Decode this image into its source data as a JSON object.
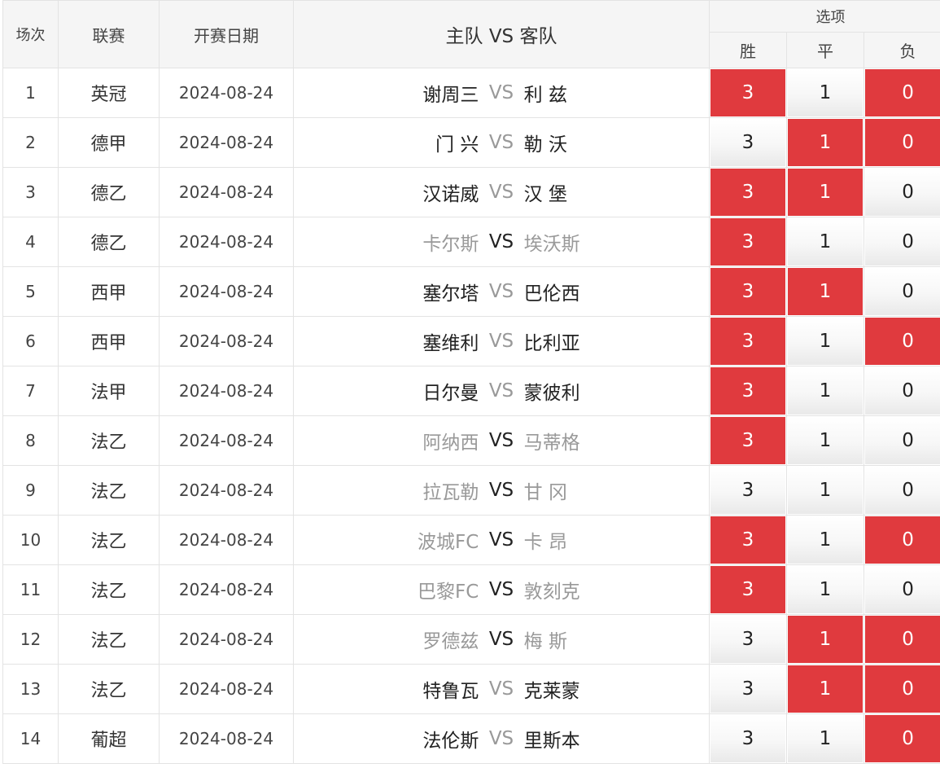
{
  "header": {
    "col_index": "场次",
    "col_league": "联赛",
    "col_date": "开赛日期",
    "col_match": "主队 VS 客队",
    "col_options": "选项",
    "opt_win": "胜",
    "opt_draw": "平",
    "opt_lose": "负"
  },
  "vs_label": "VS",
  "colors": {
    "selected": "#e03a3e",
    "unselected_text": "#222222",
    "dim_text": "#999999"
  },
  "rows": [
    {
      "idx": "1",
      "league": "英冠",
      "date": "2024-08-24",
      "home": "谢周三",
      "away": "利 兹",
      "vs_dim": true,
      "home_dim": false,
      "away_dim": false,
      "w": "3",
      "d": "1",
      "l": "0",
      "sel": [
        true,
        false,
        true
      ]
    },
    {
      "idx": "2",
      "league": "德甲",
      "date": "2024-08-24",
      "home": "门 兴",
      "away": "勒 沃",
      "vs_dim": true,
      "home_dim": false,
      "away_dim": false,
      "w": "3",
      "d": "1",
      "l": "0",
      "sel": [
        false,
        true,
        true
      ]
    },
    {
      "idx": "3",
      "league": "德乙",
      "date": "2024-08-24",
      "home": "汉诺威",
      "away": "汉 堡",
      "vs_dim": true,
      "home_dim": false,
      "away_dim": false,
      "w": "3",
      "d": "1",
      "l": "0",
      "sel": [
        true,
        true,
        false
      ]
    },
    {
      "idx": "4",
      "league": "德乙",
      "date": "2024-08-24",
      "home": "卡尔斯",
      "away": "埃沃斯",
      "vs_dim": false,
      "home_dim": true,
      "away_dim": true,
      "w": "3",
      "d": "1",
      "l": "0",
      "sel": [
        true,
        false,
        false
      ]
    },
    {
      "idx": "5",
      "league": "西甲",
      "date": "2024-08-24",
      "home": "塞尔塔",
      "away": "巴伦西",
      "vs_dim": true,
      "home_dim": false,
      "away_dim": false,
      "w": "3",
      "d": "1",
      "l": "0",
      "sel": [
        true,
        true,
        false
      ]
    },
    {
      "idx": "6",
      "league": "西甲",
      "date": "2024-08-24",
      "home": "塞维利",
      "away": "比利亚",
      "vs_dim": true,
      "home_dim": false,
      "away_dim": false,
      "w": "3",
      "d": "1",
      "l": "0",
      "sel": [
        true,
        false,
        true
      ]
    },
    {
      "idx": "7",
      "league": "法甲",
      "date": "2024-08-24",
      "home": "日尔曼",
      "away": "蒙彼利",
      "vs_dim": true,
      "home_dim": false,
      "away_dim": false,
      "w": "3",
      "d": "1",
      "l": "0",
      "sel": [
        true,
        false,
        false
      ]
    },
    {
      "idx": "8",
      "league": "法乙",
      "date": "2024-08-24",
      "home": "阿纳西",
      "away": "马蒂格",
      "vs_dim": false,
      "home_dim": true,
      "away_dim": true,
      "w": "3",
      "d": "1",
      "l": "0",
      "sel": [
        true,
        false,
        false
      ]
    },
    {
      "idx": "9",
      "league": "法乙",
      "date": "2024-08-24",
      "home": "拉瓦勒",
      "away": "甘 冈",
      "vs_dim": false,
      "home_dim": true,
      "away_dim": true,
      "w": "3",
      "d": "1",
      "l": "0",
      "sel": [
        false,
        false,
        false
      ]
    },
    {
      "idx": "10",
      "league": "法乙",
      "date": "2024-08-24",
      "home": "波城FC",
      "away": "卡 昂",
      "vs_dim": false,
      "home_dim": true,
      "away_dim": true,
      "w": "3",
      "d": "1",
      "l": "0",
      "sel": [
        true,
        false,
        true
      ]
    },
    {
      "idx": "11",
      "league": "法乙",
      "date": "2024-08-24",
      "home": "巴黎FC",
      "away": "敦刻克",
      "vs_dim": false,
      "home_dim": true,
      "away_dim": true,
      "w": "3",
      "d": "1",
      "l": "0",
      "sel": [
        true,
        false,
        false
      ]
    },
    {
      "idx": "12",
      "league": "法乙",
      "date": "2024-08-24",
      "home": "罗德兹",
      "away": "梅 斯",
      "vs_dim": false,
      "home_dim": true,
      "away_dim": true,
      "w": "3",
      "d": "1",
      "l": "0",
      "sel": [
        false,
        true,
        true
      ]
    },
    {
      "idx": "13",
      "league": "法乙",
      "date": "2024-08-24",
      "home": "特鲁瓦",
      "away": "克莱蒙",
      "vs_dim": true,
      "home_dim": false,
      "away_dim": false,
      "w": "3",
      "d": "1",
      "l": "0",
      "sel": [
        false,
        true,
        true
      ]
    },
    {
      "idx": "14",
      "league": "葡超",
      "date": "2024-08-24",
      "home": "法伦斯",
      "away": "里斯本",
      "vs_dim": true,
      "home_dim": false,
      "away_dim": false,
      "w": "3",
      "d": "1",
      "l": "0",
      "sel": [
        false,
        false,
        true
      ]
    }
  ]
}
